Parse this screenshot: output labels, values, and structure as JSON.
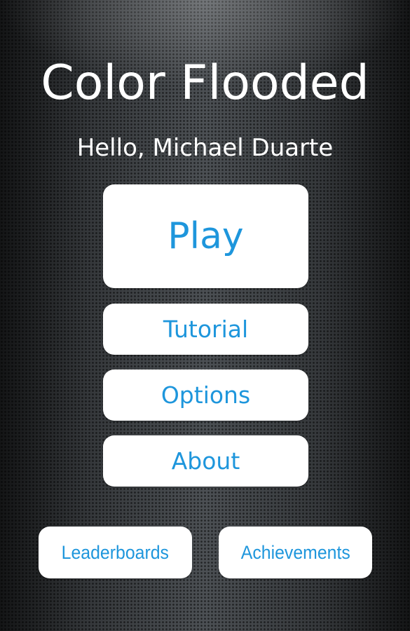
{
  "app": {
    "title": "Color Flooded",
    "greeting": "Hello, Michael Duarte"
  },
  "menu": {
    "play_label": "Play",
    "tutorial_label": "Tutorial",
    "options_label": "Options",
    "about_label": "About"
  },
  "footer": {
    "leaderboards_label": "Leaderboards",
    "achievements_label": "Achievements"
  },
  "colors": {
    "accent": "#1e96dc",
    "button_background": "#ffffff",
    "title_text": "#ffffff",
    "background": "#3a3d40"
  }
}
